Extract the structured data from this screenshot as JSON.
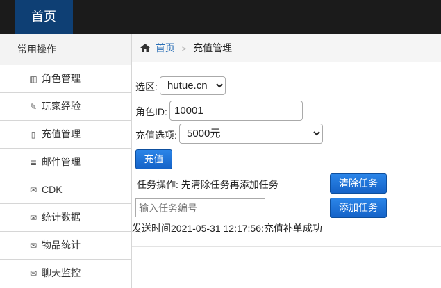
{
  "header": {
    "brand": "首页"
  },
  "sidebar": {
    "title": "常用操作",
    "items": [
      {
        "label": "角色管理",
        "icon": "book-icon",
        "glyph": "▥"
      },
      {
        "label": "玩家经验",
        "icon": "plug-icon",
        "glyph": "✎"
      },
      {
        "label": "充值管理",
        "icon": "file-icon",
        "glyph": "▯"
      },
      {
        "label": "邮件管理",
        "icon": "list-icon",
        "glyph": "≣"
      },
      {
        "label": "CDK",
        "icon": "envelope-icon",
        "glyph": "✉"
      },
      {
        "label": "统计数据",
        "icon": "envelope-icon",
        "glyph": "✉"
      },
      {
        "label": "物品统计",
        "icon": "envelope-icon",
        "glyph": "✉"
      },
      {
        "label": "聊天监控",
        "icon": "envelope-icon",
        "glyph": "✉"
      }
    ]
  },
  "breadcrumb": {
    "home": "首页",
    "current": "充值管理"
  },
  "form": {
    "server_label": "选区:",
    "server_value": "hutue.cn",
    "role_label": "角色ID:",
    "role_value": "10001",
    "amount_label": "充值选项:",
    "amount_value": "5000元",
    "recharge_button": "充值",
    "task_label": "任务操作: 先清除任务再添加任务",
    "clear_button": "清除任务",
    "task_placeholder": "输入任务编号",
    "add_button": "添加任务",
    "status": "发送时间2021-05-31 12:17:56:充值补单成功"
  },
  "colors": {
    "topbar": "#1b1b1b",
    "brand_bg": "#0e3f74",
    "button": "#1a6ed8",
    "link": "#2a6fb6"
  }
}
